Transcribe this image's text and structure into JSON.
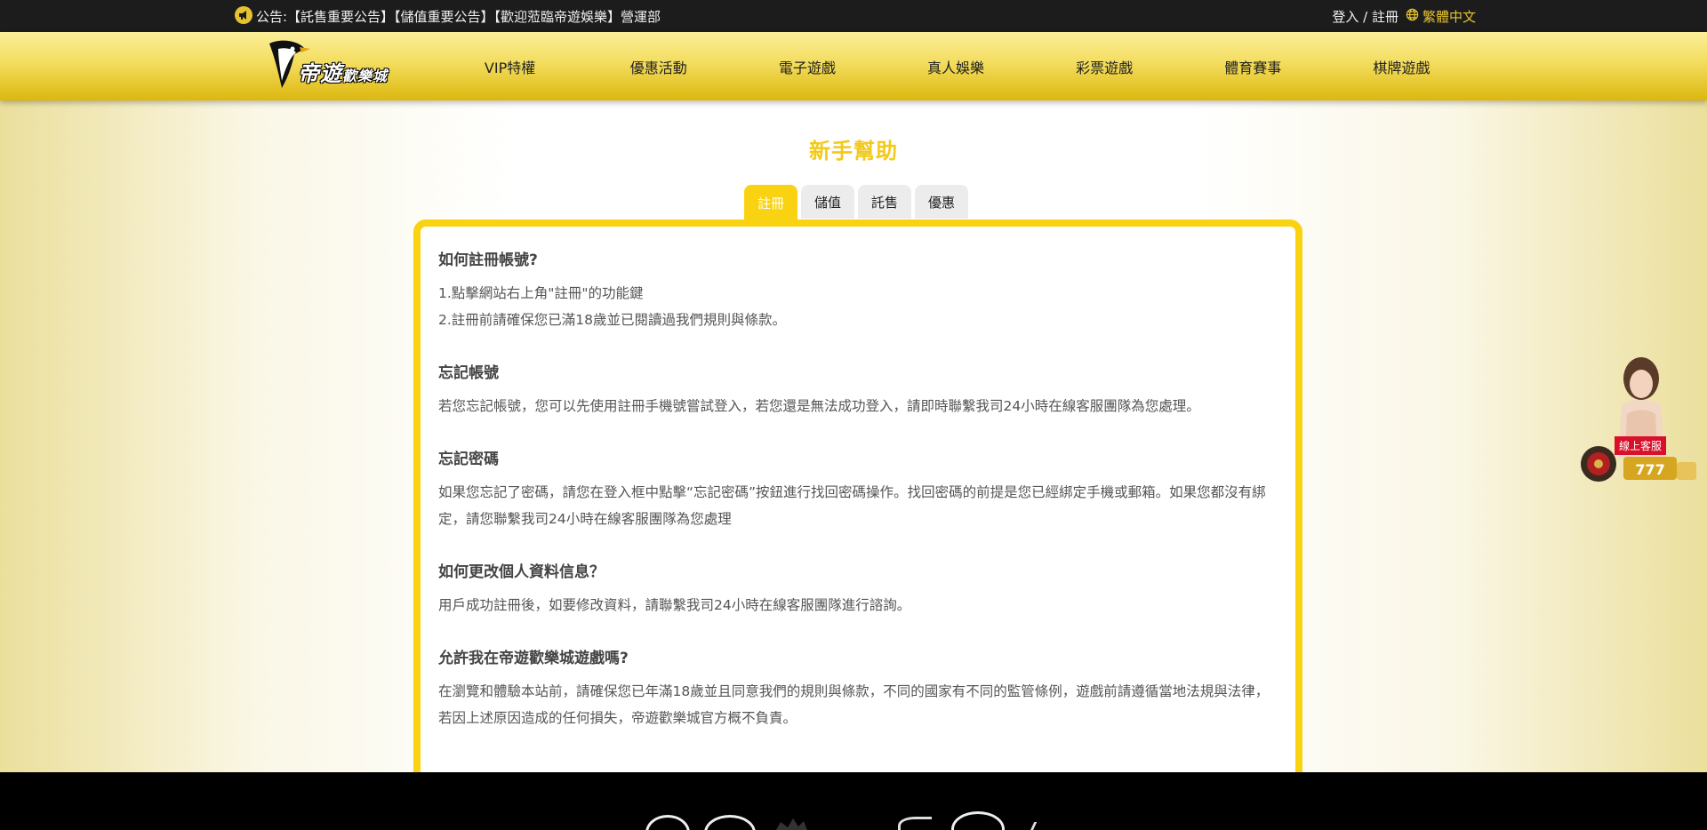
{
  "topbar": {
    "notice_text": "公告:【託售重要公告】【儲值重要公告】【歡迎蒞臨帝遊娛樂】營運部",
    "login": "登入 / 註冊",
    "language": "繁體中文"
  },
  "header": {
    "logo_main": "帝遊",
    "logo_sub": "歡樂城",
    "nav": [
      {
        "label": "VIP特權"
      },
      {
        "label": "優惠活動"
      },
      {
        "label": "電子遊戲"
      },
      {
        "label": "真人娛樂"
      },
      {
        "label": "彩票遊戲"
      },
      {
        "label": "體育賽事"
      },
      {
        "label": "棋牌遊戲"
      }
    ]
  },
  "main": {
    "title": "新手幫助",
    "tabs": [
      {
        "label": "註冊",
        "active": true
      },
      {
        "label": "儲值",
        "active": false
      },
      {
        "label": "託售",
        "active": false
      },
      {
        "label": "優惠",
        "active": false
      }
    ],
    "faqs": [
      {
        "q": "如何註冊帳號?",
        "a": [
          "1.點擊網站右上角\"註冊\"的功能鍵",
          "2.註冊前請確保您已滿18歲並已閱讀過我們規則與條款。"
        ]
      },
      {
        "q": "忘記帳號",
        "a": [
          "若您忘記帳號，您可以先使用註冊手機號嘗試登入，若您還是無法成功登入，請即時聯繫我司24小時在線客服團隊為您處理。"
        ]
      },
      {
        "q": "忘記密碼",
        "a": [
          "如果您忘記了密碼，請您在登入框中點擊“忘記密碼”按鈕進行找回密碼操作。找回密碼的前提是您已經綁定手機或郵箱。如果您都沒有綁定，請您聯繫我司24小時在線客服團隊為您處理"
        ]
      },
      {
        "q": "如何更改個人資料信息？",
        "a": [
          "用戶成功註冊後，如要修改資料，請聯繫我司24小時在線客服團隊進行諮詢。"
        ]
      },
      {
        "q": "允許我在帝遊歡樂城遊戲嗎?",
        "a": [
          "在瀏覽和體驗本站前，請確保您已年滿18歲並且同意我們的規則與條款，不同的國家有不同的監管條例，遊戲前請遵循當地法規與法律，若因上述原因造成的任何損失，帝遊歡樂城官方概不負責。"
        ]
      }
    ]
  },
  "customer_service": {
    "label": "線上客服"
  },
  "colors": {
    "accent": "#f9d211",
    "title": "#f3c91a",
    "topbar_bg": "#1c1c1c",
    "cs_red": "#d8102a"
  }
}
